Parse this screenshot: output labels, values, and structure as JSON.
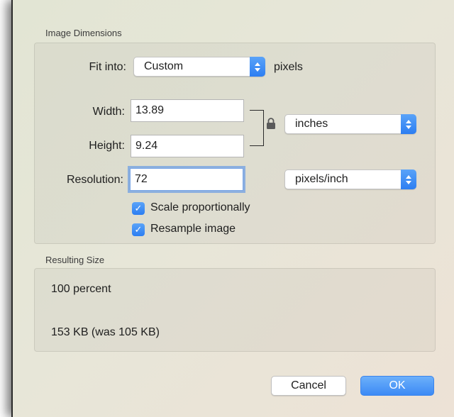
{
  "image_dimensions": {
    "section_title": "Image Dimensions",
    "fit_into": {
      "label": "Fit into:",
      "value": "Custom",
      "unit": "pixels"
    },
    "width": {
      "label": "Width:",
      "value": "13.89"
    },
    "height": {
      "label": "Height:",
      "value": "9.24"
    },
    "size_unit": {
      "value": "inches"
    },
    "resolution": {
      "label": "Resolution:",
      "value": "72"
    },
    "resolution_unit": {
      "value": "pixels/inch"
    },
    "scale_proportionally": {
      "label": "Scale proportionally",
      "checked": true
    },
    "resample_image": {
      "label": "Resample image",
      "checked": true
    }
  },
  "resulting_size": {
    "section_title": "Resulting Size",
    "percent": "100 percent",
    "file_size": "153 KB (was 105 KB)"
  },
  "buttons": {
    "cancel": "Cancel",
    "ok": "OK"
  },
  "colors": {
    "accent": "#2c7ef2",
    "focus_ring": "#6096e6"
  }
}
